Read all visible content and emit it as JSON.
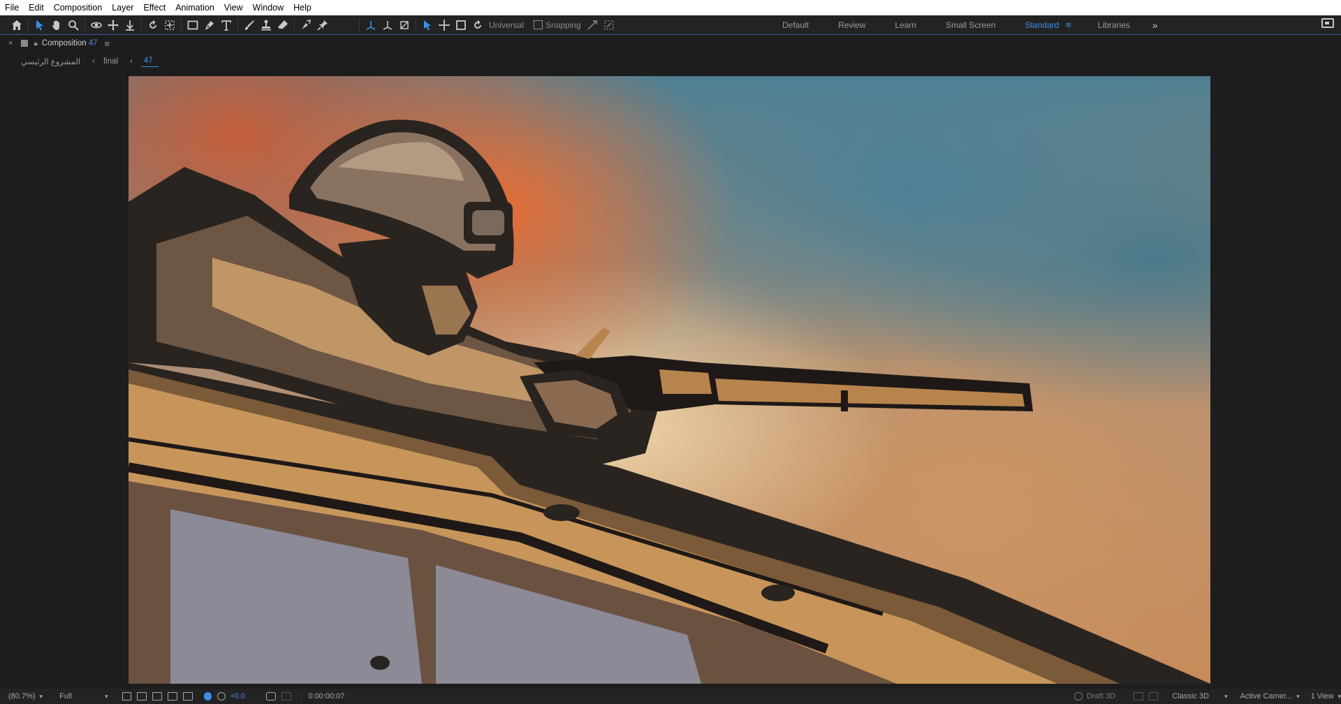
{
  "menu": [
    "File",
    "Edit",
    "Composition",
    "Layer",
    "Effect",
    "Animation",
    "View",
    "Window",
    "Help"
  ],
  "toolbar": {
    "universal_label": "Universal",
    "snapping_label": "Snapping",
    "tools": [
      "home-icon",
      "selection-icon",
      "hand-icon",
      "zoom-icon",
      "orbit-icon",
      "pan-icon",
      "dolly-icon",
      "rotate-icon",
      "pan-behind-icon",
      "rectangle-icon",
      "pen-icon",
      "text-icon",
      "brush-icon",
      "clone-stamp-icon",
      "eraser-icon",
      "roto-brush-icon",
      "puppet-icon"
    ]
  },
  "workspaces": {
    "items": [
      "Default",
      "Review",
      "Learn",
      "Small Screen",
      "Standard",
      "Libraries"
    ],
    "active": "Standard",
    "more": "»"
  },
  "panel": {
    "close": "×",
    "title": "Composition",
    "number": "47",
    "menu": "≡"
  },
  "breadcrumb": {
    "items": [
      "المشروع الرئيسي",
      "final",
      "47"
    ],
    "separator": "‹"
  },
  "statusbar": {
    "zoom": "(80.7%)",
    "resolution": "Full",
    "exposure": "+0.0",
    "timecode": "0:00:00:07",
    "draft3d": "Draft 3D",
    "renderer": "Classic 3D",
    "camera": "Active Camer...",
    "views": "1 View"
  },
  "colors": {
    "accent": "#3d8ee8",
    "panel_bg": "#1d1d1d",
    "toolbar_bg": "#232323"
  }
}
